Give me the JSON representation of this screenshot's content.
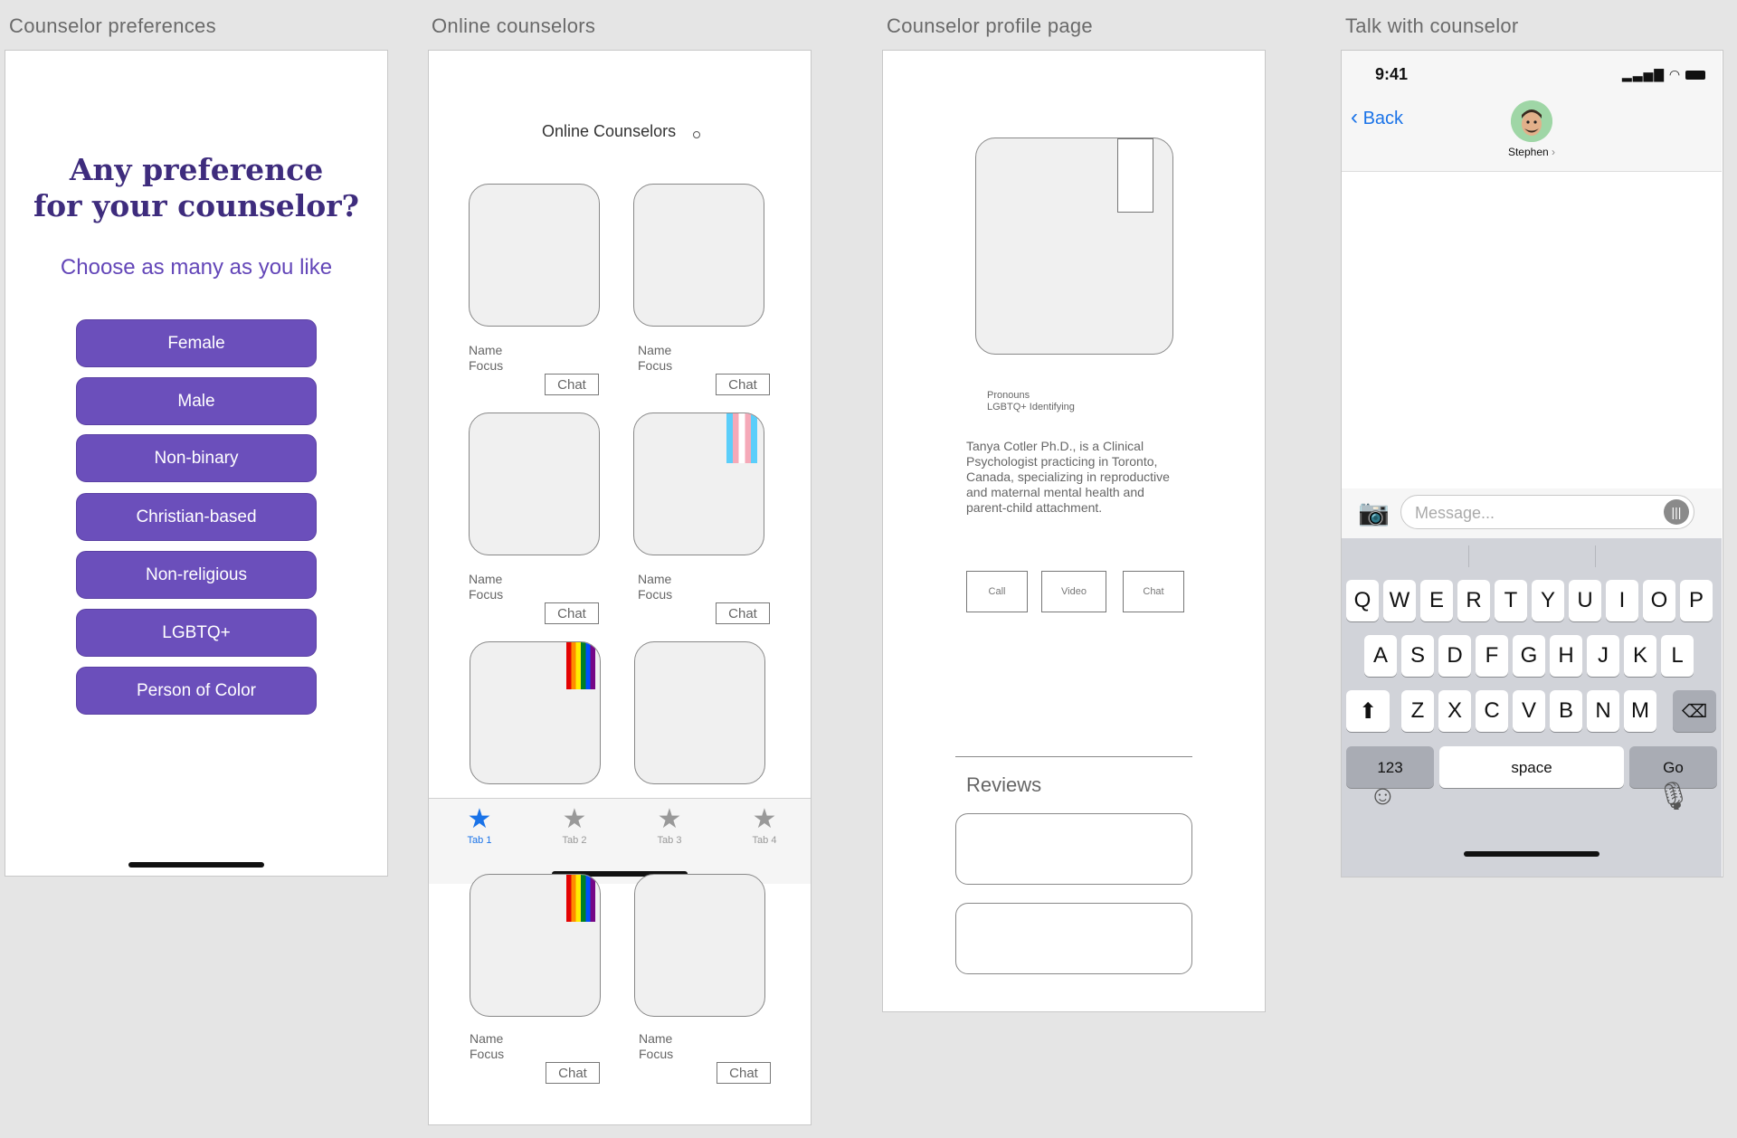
{
  "frames": {
    "f1": "Counselor preferences",
    "f2": "Online counselors",
    "f3": "Counselor profile page",
    "f4": "Talk with counselor"
  },
  "prefs": {
    "heading_line1": "Any preference",
    "heading_line2": "for your counselor?",
    "subheading": "Choose as many as you like",
    "options": [
      "Female",
      "Male",
      "Non-binary",
      "Christian-based",
      "Non-religious",
      "LGBTQ+",
      "Person of Color"
    ]
  },
  "online": {
    "title": "Online Counselors",
    "name_label": "Name",
    "focus_label": "Focus",
    "chat_label": "Chat",
    "tabs": [
      "Tab 1",
      "Tab 2",
      "Tab 3",
      "Tab 4"
    ]
  },
  "profile": {
    "pronouns": "Pronouns",
    "identifying": "LGBTQ+ Identifying",
    "bio": "Tanya Cotler Ph.D., is a Clinical Psychologist practicing in Toronto, Canada, specializing in reproductive and maternal mental health and parent-child attachment.",
    "call": "Call",
    "video": "Video",
    "chat": "Chat",
    "reviews": "Reviews"
  },
  "messages": {
    "time": "9:41",
    "back": "Back",
    "contact": "Stephen",
    "placeholder": "Message...",
    "row1": [
      "Q",
      "W",
      "E",
      "R",
      "T",
      "Y",
      "U",
      "I",
      "O",
      "P"
    ],
    "row2": [
      "A",
      "S",
      "D",
      "F",
      "G",
      "H",
      "J",
      "K",
      "L"
    ],
    "row3": [
      "Z",
      "X",
      "C",
      "V",
      "B",
      "N",
      "M"
    ],
    "numbers_key": "123",
    "space_key": "space",
    "go_key": "Go"
  },
  "colors": {
    "brand_purple": "#6b4fbb",
    "heading_purple": "#3e2c7d",
    "ios_blue": "#1a73e8"
  }
}
